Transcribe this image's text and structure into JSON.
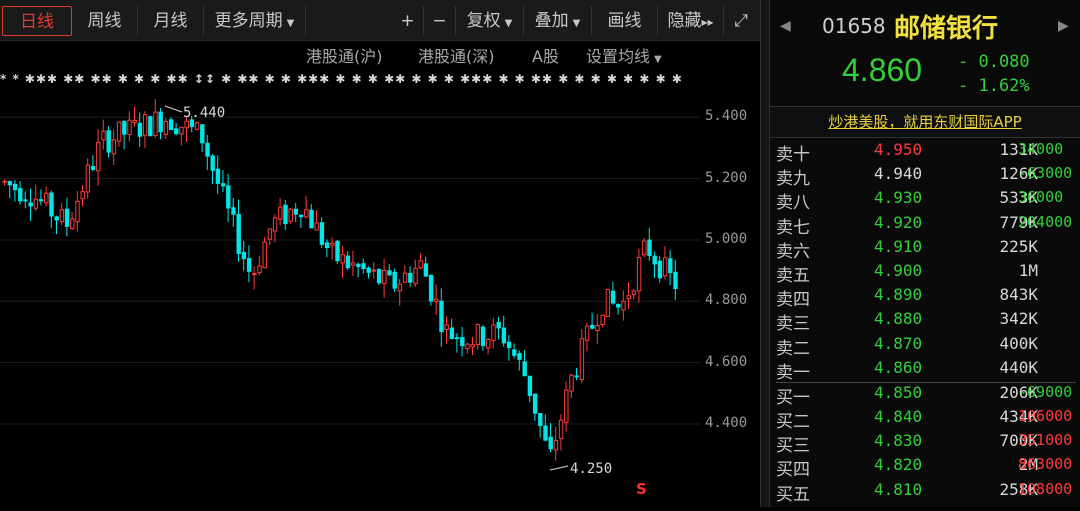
{
  "toolbar": {
    "periods": [
      "日线",
      "周线",
      "月线",
      "更多周期"
    ],
    "plus": "+",
    "minus": "−",
    "adjust": "复权",
    "overlay": "叠加",
    "draw": "画线",
    "hide": "隐藏",
    "hide_arrows": "▸▸",
    "expand": "⤢"
  },
  "subbar": {
    "hk_sh": "港股通(沪)",
    "hk_sz": "港股通(深)",
    "a_share": "A股",
    "ma_settings": "设置均线"
  },
  "markers": "* * ✱✱✱ ✱✱ ✱✱ ✱ ✱ ✱ ✱✱ ↕↕ ✱ ✱✱ ✱ ✱ ✱✱✱ ✱ ✱ ✱ ✱✱ ✱ ✱ ✱ ✱✱✱ ✱ ✱ ✱✱ ✱ ✱ ✱ ✱ ✱ ✱ ✱ ✱ ↕ ↕ ↕ ✱ ✱ ✱ ✱",
  "annotations": {
    "high": "5.440",
    "low": "4.250"
  },
  "chart_data": {
    "type": "candlestick",
    "ylim": [
      4.25,
      5.45
    ],
    "yticks": [
      "5.400",
      "5.200",
      "5.000",
      "4.800",
      "4.600",
      "4.400"
    ],
    "high": 5.44,
    "low": 4.25
  },
  "stock": {
    "code": "01658",
    "name": "邮储银行",
    "price": "4.860",
    "change": "- 0.080",
    "change_pct": "- 1.62%"
  },
  "ad_text": "炒港美股，就用东财国际APP",
  "order_book": {
    "asks": [
      {
        "label": "卖十",
        "price": "4.950",
        "vol": "131K",
        "extra": "34000",
        "pcolor": "#ff3a3a"
      },
      {
        "label": "卖九",
        "price": "4.940",
        "vol": "126K",
        "extra": "-63000",
        "pcolor": "#d8d8d8"
      },
      {
        "label": "卖八",
        "price": "4.930",
        "vol": "533K",
        "extra": "36000",
        "pcolor": "#33d03a"
      },
      {
        "label": "卖七",
        "price": "4.920",
        "vol": "779K",
        "extra": "204000",
        "pcolor": "#33d03a"
      },
      {
        "label": "卖六",
        "price": "4.910",
        "vol": "225K",
        "extra": "",
        "pcolor": "#33d03a"
      },
      {
        "label": "卖五",
        "price": "4.900",
        "vol": "1M",
        "extra": "",
        "pcolor": "#33d03a"
      },
      {
        "label": "卖四",
        "price": "4.890",
        "vol": "843K",
        "extra": "",
        "pcolor": "#33d03a"
      },
      {
        "label": "卖三",
        "price": "4.880",
        "vol": "342K",
        "extra": "",
        "pcolor": "#33d03a"
      },
      {
        "label": "卖二",
        "price": "4.870",
        "vol": "400K",
        "extra": "",
        "pcolor": "#33d03a"
      },
      {
        "label": "卖一",
        "price": "4.860",
        "vol": "440K",
        "extra": "",
        "pcolor": "#33d03a"
      }
    ],
    "bids": [
      {
        "label": "买一",
        "price": "4.850",
        "vol": "206K",
        "extra": "-69000",
        "pcolor": "#33d03a"
      },
      {
        "label": "买二",
        "price": "4.840",
        "vol": "434K",
        "extra": "106000",
        "pcolor": "#33d03a"
      },
      {
        "label": "买三",
        "price": "4.830",
        "vol": "700K",
        "extra": "351000",
        "pcolor": "#33d03a"
      },
      {
        "label": "买四",
        "price": "4.820",
        "vol": "2M",
        "extra": "863000",
        "pcolor": "#33d03a"
      },
      {
        "label": "买五",
        "price": "4.810",
        "vol": "258K",
        "extra": "108000",
        "pcolor": "#33d03a"
      }
    ]
  },
  "colors": {
    "up": "#ff3a3a",
    "down": "#00e6e6",
    "green": "#33d03a",
    "red_extra": "#ff3a3a"
  }
}
